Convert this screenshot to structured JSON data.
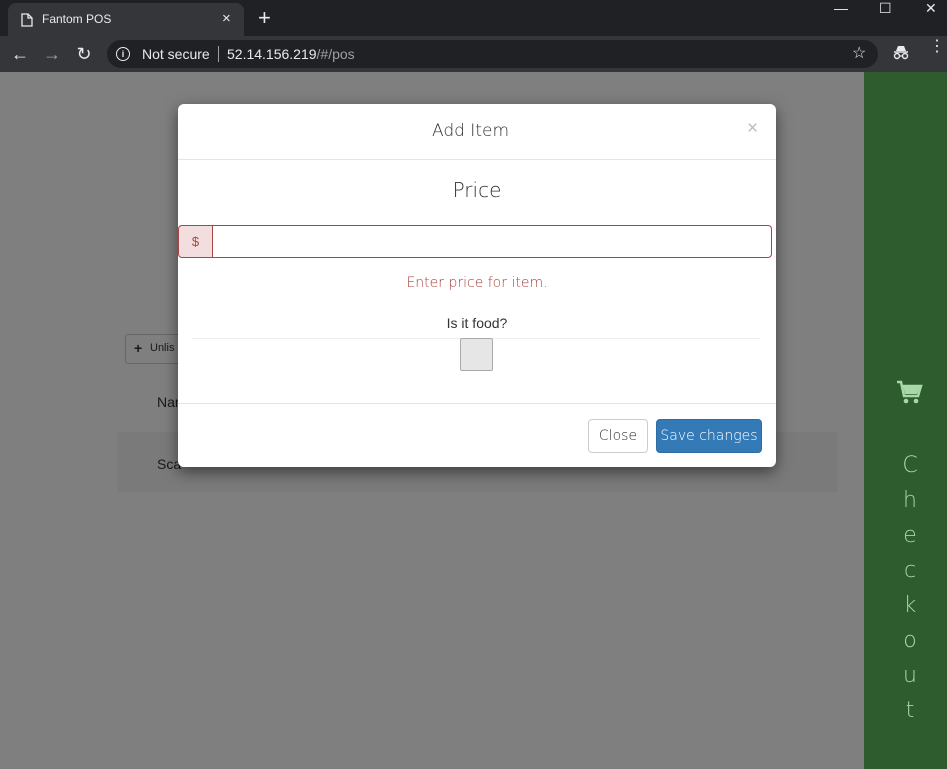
{
  "browser": {
    "tab_title": "Fantom POS",
    "tab_close": "×",
    "new_tab": "+",
    "security_label": "Not secure",
    "url_host": "52.14.156.219",
    "url_path": "/#/pos",
    "window_min": "—",
    "window_max": "☐",
    "window_close": "✕"
  },
  "page": {
    "unlist_button": "Unlis",
    "name_header": "Nar",
    "scan_text": "Sca",
    "checkout_letters": [
      "C",
      "h",
      "e",
      "c",
      "k",
      "o",
      "u",
      "t"
    ],
    "accent_color": "#5cb85c"
  },
  "modal": {
    "title": "Add Item",
    "close_glyph": "×",
    "price_label": "Price",
    "currency_symbol": "$",
    "price_value": "",
    "price_error": "Enter price for item.",
    "food_question": "Is it food?",
    "food_checked": false,
    "close_button": "Close",
    "save_button": "Save changes",
    "error_color": "#a94442",
    "primary_color": "#337ab7"
  }
}
